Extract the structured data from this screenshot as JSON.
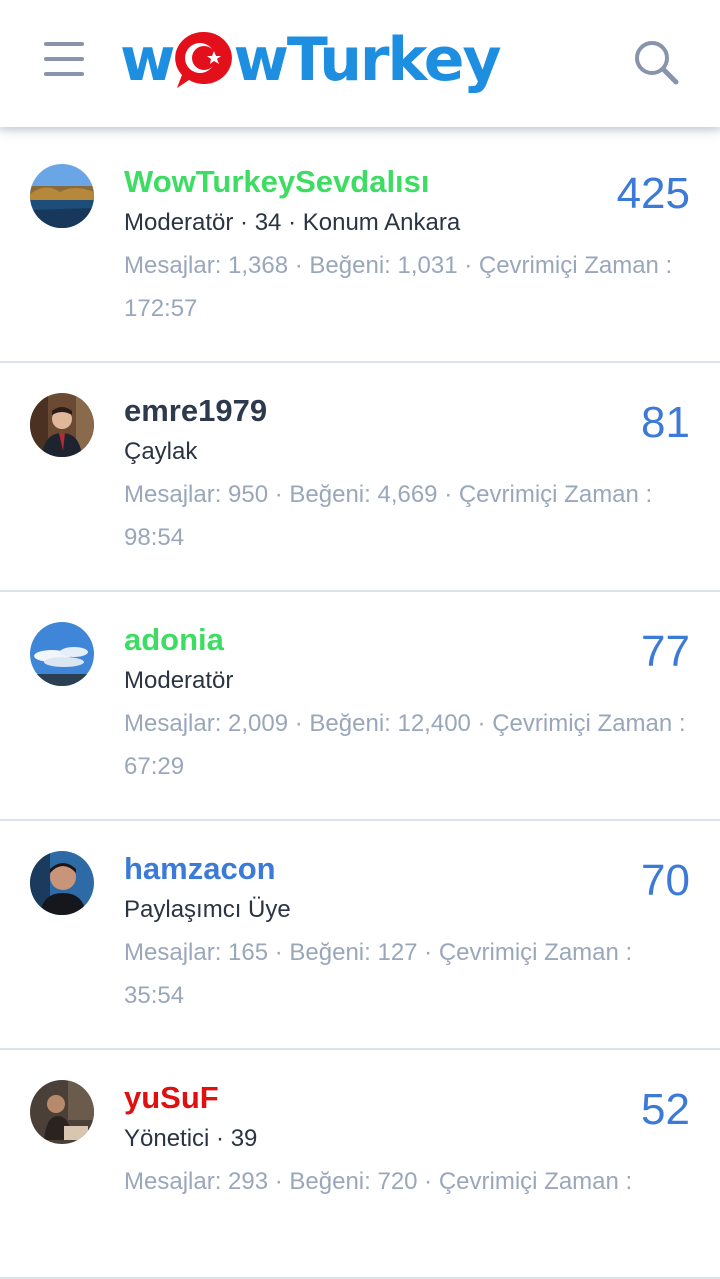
{
  "header": {
    "logo_text_left": "w",
    "logo_text_right": "wTurkey",
    "menu_icon": "hamburger-menu-icon",
    "search_icon": "search-icon",
    "brand_color": "#1e8fe0",
    "flag_color": "#e3101b"
  },
  "members": [
    {
      "name": "WowTurkeySevdalısı",
      "name_color": "#3ddc62",
      "role": "Moderatör · 34 · Konum Ankara",
      "stats": "Mesajlar: 1,368 · Beğeni: 1,031 · Çevrimiçi Zaman : 172:57",
      "count": "425",
      "avatar": "lake-landscape-avatar"
    },
    {
      "name": "emre1979",
      "name_color": "#2d3a4e",
      "role": "Çaylak",
      "stats": "Mesajlar: 950 · Beğeni: 4,669 · Çevrimiçi Zaman : 98:54",
      "count": "81",
      "avatar": "man-in-suit-avatar"
    },
    {
      "name": "adonia",
      "name_color": "#3ddc62",
      "role": "Moderatör",
      "stats": "Mesajlar: 2,009 · Beğeni: 12,400 · Çevrimiçi Zaman : 67:29",
      "count": "77",
      "avatar": "sky-clouds-avatar"
    },
    {
      "name": "hamzacon",
      "name_color": "#3c7ad8",
      "role": "Paylaşımcı Üye",
      "stats": "Mesajlar: 165 · Beğeni: 127 · Çevrimiçi Zaman : 35:54",
      "count": "70",
      "avatar": "man-portrait-avatar"
    },
    {
      "name": "yuSuF",
      "name_color": "#e01010",
      "role": "Yönetici · 39",
      "stats": "Mesajlar: 293 · Beğeni: 720 · Çevrimiçi Zaman :",
      "count": "52",
      "avatar": "workshop-avatar"
    }
  ]
}
